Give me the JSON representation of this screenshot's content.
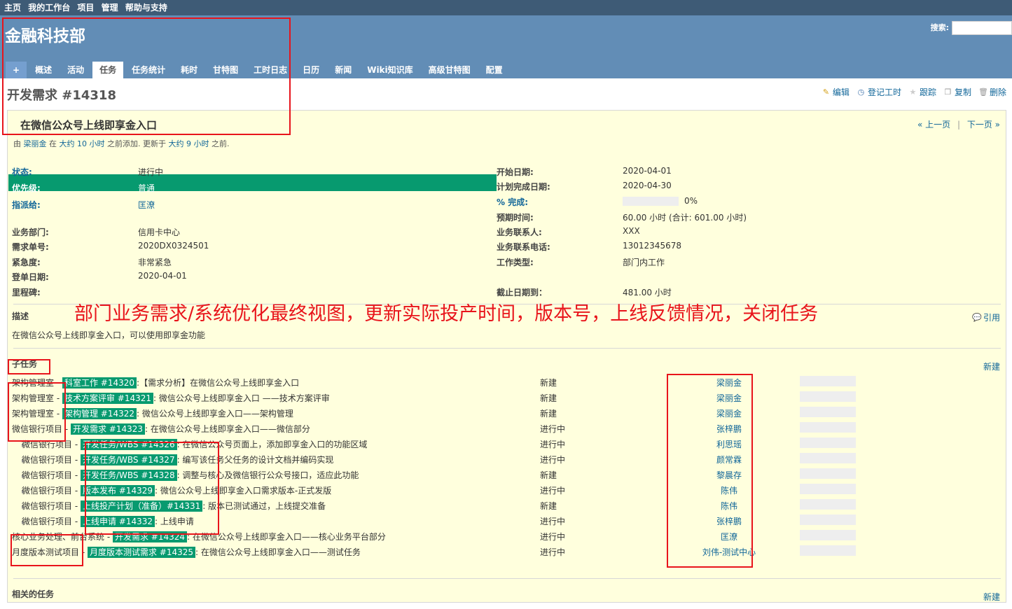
{
  "top_menu": [
    "主页",
    "我的工作台",
    "项目",
    "管理",
    "帮助与支持"
  ],
  "project_title": "金融科技部",
  "search_label": "搜索:",
  "tabs": [
    {
      "label": "+"
    },
    {
      "label": "概述"
    },
    {
      "label": "活动"
    },
    {
      "label": "任务"
    },
    {
      "label": "任务统计"
    },
    {
      "label": "耗时"
    },
    {
      "label": "甘特图"
    },
    {
      "label": "工时日志"
    },
    {
      "label": "日历"
    },
    {
      "label": "新闻"
    },
    {
      "label": "Wiki知识库"
    },
    {
      "label": "高级甘特图"
    },
    {
      "label": "配置"
    }
  ],
  "issue": {
    "title": "开发需求 #14318",
    "subject": "在微信公众号上线即享金入口",
    "author_prefix": "由",
    "author": "梁丽金",
    "added_prefix": "在",
    "added_time": "大约 10 小时",
    "added_suffix": "之前添加. 更新于",
    "updated_time": "大约 9 小时",
    "updated_suffix": "之前.",
    "prev": "« 上一页",
    "sep": "|",
    "next": "下一页 »"
  },
  "contextual": [
    {
      "label": "编辑",
      "icon": "edit-icon"
    },
    {
      "label": "登记工时",
      "icon": "time-icon"
    },
    {
      "label": "跟踪",
      "icon": "star-icon"
    },
    {
      "label": "复制",
      "icon": "copy-icon"
    },
    {
      "label": "删除",
      "icon": "delete-icon"
    }
  ],
  "attributes_left": [
    {
      "label": "状态:",
      "value": "进行中"
    },
    {
      "label": "优先级:",
      "value": "普通"
    },
    {
      "label": "指派给:",
      "value": "匡潦"
    },
    {
      "label": "业务部门:",
      "value": "信用卡中心"
    },
    {
      "label": "需求单号:",
      "value": "2020DX0324501"
    },
    {
      "label": "紧急度:",
      "value": "非常紧急"
    },
    {
      "label": "登单日期:",
      "value": "2020-04-01"
    },
    {
      "label": "里程碑:",
      "value": ""
    }
  ],
  "attributes_right": [
    {
      "label": "开始日期:",
      "value": "2020-04-01"
    },
    {
      "label": "计划完成日期:",
      "value": "2020-04-30"
    },
    {
      "label": "% 完成:",
      "value": "0%"
    },
    {
      "label": "预期时间:",
      "value": "60.00 小时 (合计: 601.00 小时)"
    },
    {
      "label": "业务联系人:",
      "value": "XXX"
    },
    {
      "label": "业务联系电话:",
      "value": "13012345678"
    },
    {
      "label": "工作类型:",
      "value": "部门内工作"
    },
    {
      "label": "截止日期到：",
      "value": "481.00 小时"
    }
  ],
  "done_ratio": 0,
  "description": {
    "label": "描述",
    "annotation": "部门业务需求/系统优化最终视图，更新实际投产时间，版本号，上线反馈情况，关闭任务",
    "quote": "引用",
    "text": "在微信公众号上线即享金入口，可以使用即享金功能"
  },
  "subtasks": {
    "label": "子任务",
    "new": "新建",
    "rows": [
      {
        "project": "架构管理室",
        "tag": "科室工作 #14320",
        "subject": ":【需求分析】在微信公众号上线即享金入口",
        "status": "新建",
        "assignee": "梁丽金",
        "child": false
      },
      {
        "project": "架构管理室",
        "tag": "技术方案评审 #14321",
        "subject": ": 微信公众号上线即享金入口 ——技术方案评审",
        "status": "新建",
        "assignee": "梁丽金",
        "child": false
      },
      {
        "project": "架构管理室",
        "tag": "架构管理 #14322",
        "subject": ": 微信公众号上线即享金入口——架构管理",
        "status": "新建",
        "assignee": "梁丽金",
        "child": false
      },
      {
        "project": "微信银行项目",
        "tag": "开发需求 #14323",
        "subject": ": 在微信公众号上线即享金入口——微信部分",
        "status": "进行中",
        "assignee": "张梓鹏",
        "child": false
      },
      {
        "project": "微信银行项目",
        "tag": "开发任务/WBS #14326",
        "subject": ": 在微信公众号页面上，添加即享金入口的功能区域",
        "status": "进行中",
        "assignee": "利思瑶",
        "child": true
      },
      {
        "project": "微信银行项目",
        "tag": "开发任务/WBS #14327",
        "subject": ": 编写该任务父任务的设计文档并编码实现",
        "status": "进行中",
        "assignee": "颜常霖",
        "child": true
      },
      {
        "project": "微信银行项目",
        "tag": "开发任务/WBS #14328",
        "subject": ": 调整与核心及微信银行公众号接口，适应此功能",
        "status": "新建",
        "assignee": "黎晨存",
        "child": true
      },
      {
        "project": "微信银行项目",
        "tag": "版本发布 #14329",
        "subject": ": 微信公众号上线即享金入口需求版本-正式发版",
        "status": "进行中",
        "assignee": "陈伟",
        "child": true
      },
      {
        "project": "微信银行项目",
        "tag": "上线投产计划（准备）#14331",
        "subject": ": 版本已测试通过，上线提交准备",
        "status": "新建",
        "assignee": "陈伟",
        "child": true
      },
      {
        "project": "微信银行项目",
        "tag": "上线申请 #14332",
        "subject": ": 上线申请",
        "status": "进行中",
        "assignee": "张梓鹏",
        "child": true
      },
      {
        "project": "核心业务处理、前台系统",
        "tag": "开发需求 #14324",
        "subject": ": 在微信公众号上线即享金入口——核心业务平台部分",
        "status": "进行中",
        "assignee": "匡潦",
        "child": false
      },
      {
        "project": "月度版本测试项目",
        "tag": "月度版本测试需求 #14325",
        "subject": ": 在微信公众号上线即享金入口——测试任务",
        "status": "进行中",
        "assignee": "刘伟-测试中心",
        "child": false
      }
    ]
  },
  "related": {
    "label": "相关的任务",
    "new": "新建"
  },
  "colors": {
    "header": "#628db6",
    "topbar": "#3e5b76",
    "tag": "#079a6f",
    "annotation": "#e8141b",
    "issue_bg": "#ffffdd"
  }
}
